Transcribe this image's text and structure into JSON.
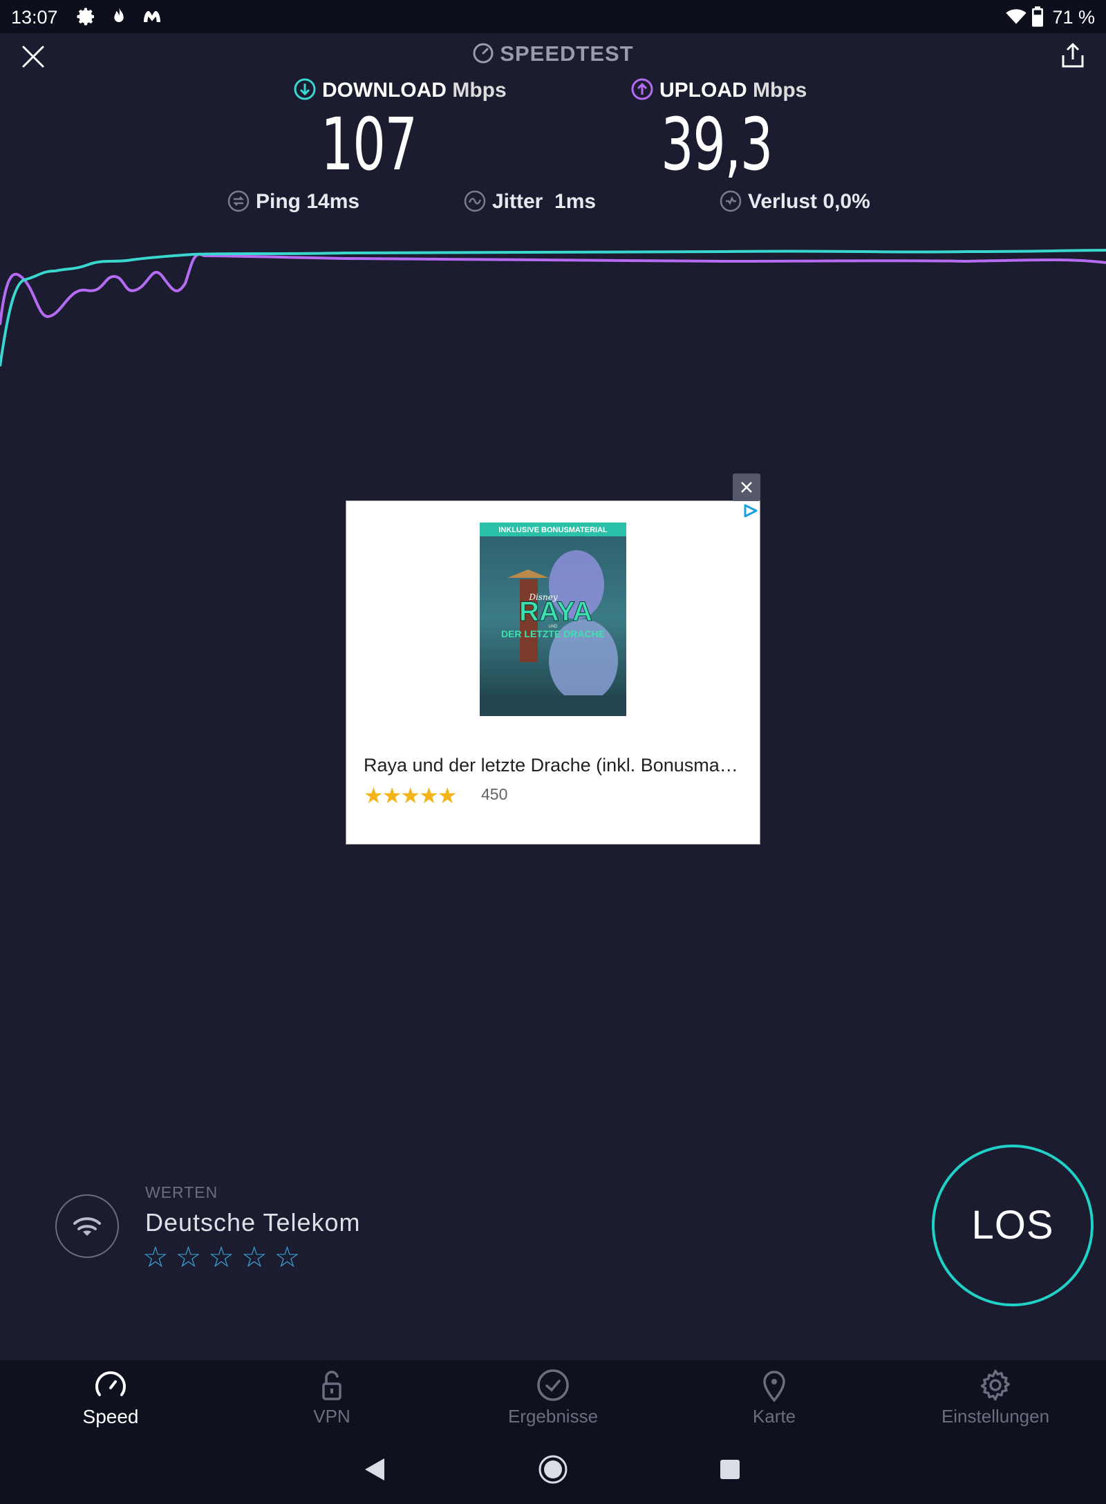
{
  "status_bar": {
    "time": "13:07",
    "battery": "71 %",
    "icons": [
      "gear-icon",
      "flame-icon",
      "malwarebytes-icon",
      "wifi-icon",
      "battery-icon"
    ]
  },
  "header": {
    "title": "SPEEDTEST"
  },
  "download": {
    "label": "DOWNLOAD",
    "unit": "Mbps",
    "value": "107",
    "color": "#3ad6d0"
  },
  "upload": {
    "label": "UPLOAD",
    "unit": "Mbps",
    "value": "39,3",
    "color": "#b56cf2"
  },
  "ping": {
    "label": "Ping",
    "value": "14ms"
  },
  "jitter": {
    "label": "Jitter",
    "value": "1ms"
  },
  "loss": {
    "label": "Verlust",
    "value": "0,0%"
  },
  "ad": {
    "poster_banner": "INKLUSIVE BONUSMATERIAL",
    "poster_brand": "Disney",
    "poster_title": "RAYA",
    "poster_und": "UND",
    "poster_subtitle": "DER LETZTE DRACHE",
    "title": "Raya und der letzte Drache (inkl. Bonusma…",
    "stars": "★★★★★",
    "rating": 5,
    "reviews": "450"
  },
  "rating_section": {
    "label": "WERTEN",
    "provider": "Deutsche Telekom",
    "stars": "☆☆☆☆☆",
    "rating": 0
  },
  "go_button": {
    "label": "LOS"
  },
  "nav": {
    "speed": "Speed",
    "vpn": "VPN",
    "results": "Ergebnisse",
    "map": "Karte",
    "settings": "Einstellungen"
  }
}
